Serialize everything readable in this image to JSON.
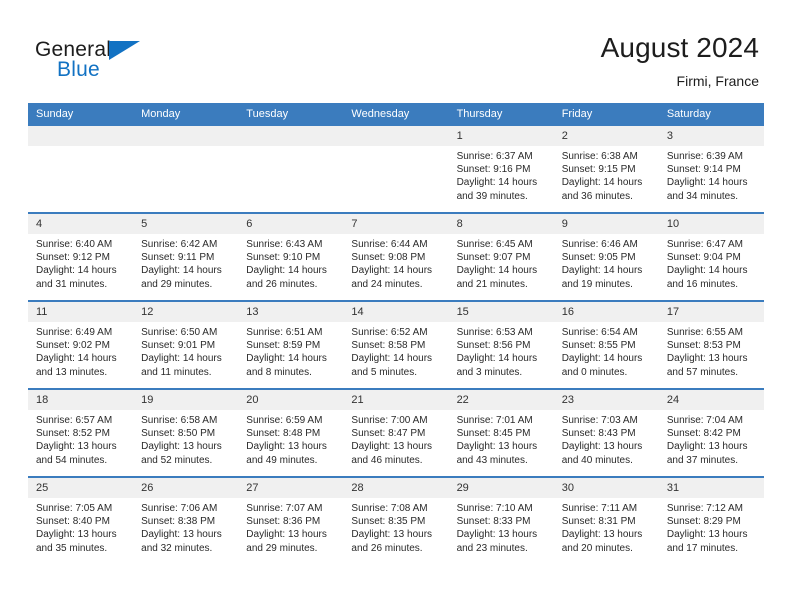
{
  "logo": {
    "primary_text": "General",
    "secondary_text": "Blue",
    "accent_color": "#1272c3"
  },
  "header": {
    "title": "August 2024",
    "location": "Firmi, France",
    "header_bg_color": "#3b7cbe"
  },
  "weekday_headers": [
    "Sunday",
    "Monday",
    "Tuesday",
    "Wednesday",
    "Thursday",
    "Friday",
    "Saturday"
  ],
  "weeks": [
    [
      {
        "date": "",
        "sunrise": "",
        "sunset": "",
        "daylight": ""
      },
      {
        "date": "",
        "sunrise": "",
        "sunset": "",
        "daylight": ""
      },
      {
        "date": "",
        "sunrise": "",
        "sunset": "",
        "daylight": ""
      },
      {
        "date": "",
        "sunrise": "",
        "sunset": "",
        "daylight": ""
      },
      {
        "date": "1",
        "sunrise": "Sunrise: 6:37 AM",
        "sunset": "Sunset: 9:16 PM",
        "daylight": "Daylight: 14 hours and 39 minutes."
      },
      {
        "date": "2",
        "sunrise": "Sunrise: 6:38 AM",
        "sunset": "Sunset: 9:15 PM",
        "daylight": "Daylight: 14 hours and 36 minutes."
      },
      {
        "date": "3",
        "sunrise": "Sunrise: 6:39 AM",
        "sunset": "Sunset: 9:14 PM",
        "daylight": "Daylight: 14 hours and 34 minutes."
      }
    ],
    [
      {
        "date": "4",
        "sunrise": "Sunrise: 6:40 AM",
        "sunset": "Sunset: 9:12 PM",
        "daylight": "Daylight: 14 hours and 31 minutes."
      },
      {
        "date": "5",
        "sunrise": "Sunrise: 6:42 AM",
        "sunset": "Sunset: 9:11 PM",
        "daylight": "Daylight: 14 hours and 29 minutes."
      },
      {
        "date": "6",
        "sunrise": "Sunrise: 6:43 AM",
        "sunset": "Sunset: 9:10 PM",
        "daylight": "Daylight: 14 hours and 26 minutes."
      },
      {
        "date": "7",
        "sunrise": "Sunrise: 6:44 AM",
        "sunset": "Sunset: 9:08 PM",
        "daylight": "Daylight: 14 hours and 24 minutes."
      },
      {
        "date": "8",
        "sunrise": "Sunrise: 6:45 AM",
        "sunset": "Sunset: 9:07 PM",
        "daylight": "Daylight: 14 hours and 21 minutes."
      },
      {
        "date": "9",
        "sunrise": "Sunrise: 6:46 AM",
        "sunset": "Sunset: 9:05 PM",
        "daylight": "Daylight: 14 hours and 19 minutes."
      },
      {
        "date": "10",
        "sunrise": "Sunrise: 6:47 AM",
        "sunset": "Sunset: 9:04 PM",
        "daylight": "Daylight: 14 hours and 16 minutes."
      }
    ],
    [
      {
        "date": "11",
        "sunrise": "Sunrise: 6:49 AM",
        "sunset": "Sunset: 9:02 PM",
        "daylight": "Daylight: 14 hours and 13 minutes."
      },
      {
        "date": "12",
        "sunrise": "Sunrise: 6:50 AM",
        "sunset": "Sunset: 9:01 PM",
        "daylight": "Daylight: 14 hours and 11 minutes."
      },
      {
        "date": "13",
        "sunrise": "Sunrise: 6:51 AM",
        "sunset": "Sunset: 8:59 PM",
        "daylight": "Daylight: 14 hours and 8 minutes."
      },
      {
        "date": "14",
        "sunrise": "Sunrise: 6:52 AM",
        "sunset": "Sunset: 8:58 PM",
        "daylight": "Daylight: 14 hours and 5 minutes."
      },
      {
        "date": "15",
        "sunrise": "Sunrise: 6:53 AM",
        "sunset": "Sunset: 8:56 PM",
        "daylight": "Daylight: 14 hours and 3 minutes."
      },
      {
        "date": "16",
        "sunrise": "Sunrise: 6:54 AM",
        "sunset": "Sunset: 8:55 PM",
        "daylight": "Daylight: 14 hours and 0 minutes."
      },
      {
        "date": "17",
        "sunrise": "Sunrise: 6:55 AM",
        "sunset": "Sunset: 8:53 PM",
        "daylight": "Daylight: 13 hours and 57 minutes."
      }
    ],
    [
      {
        "date": "18",
        "sunrise": "Sunrise: 6:57 AM",
        "sunset": "Sunset: 8:52 PM",
        "daylight": "Daylight: 13 hours and 54 minutes."
      },
      {
        "date": "19",
        "sunrise": "Sunrise: 6:58 AM",
        "sunset": "Sunset: 8:50 PM",
        "daylight": "Daylight: 13 hours and 52 minutes."
      },
      {
        "date": "20",
        "sunrise": "Sunrise: 6:59 AM",
        "sunset": "Sunset: 8:48 PM",
        "daylight": "Daylight: 13 hours and 49 minutes."
      },
      {
        "date": "21",
        "sunrise": "Sunrise: 7:00 AM",
        "sunset": "Sunset: 8:47 PM",
        "daylight": "Daylight: 13 hours and 46 minutes."
      },
      {
        "date": "22",
        "sunrise": "Sunrise: 7:01 AM",
        "sunset": "Sunset: 8:45 PM",
        "daylight": "Daylight: 13 hours and 43 minutes."
      },
      {
        "date": "23",
        "sunrise": "Sunrise: 7:03 AM",
        "sunset": "Sunset: 8:43 PM",
        "daylight": "Daylight: 13 hours and 40 minutes."
      },
      {
        "date": "24",
        "sunrise": "Sunrise: 7:04 AM",
        "sunset": "Sunset: 8:42 PM",
        "daylight": "Daylight: 13 hours and 37 minutes."
      }
    ],
    [
      {
        "date": "25",
        "sunrise": "Sunrise: 7:05 AM",
        "sunset": "Sunset: 8:40 PM",
        "daylight": "Daylight: 13 hours and 35 minutes."
      },
      {
        "date": "26",
        "sunrise": "Sunrise: 7:06 AM",
        "sunset": "Sunset: 8:38 PM",
        "daylight": "Daylight: 13 hours and 32 minutes."
      },
      {
        "date": "27",
        "sunrise": "Sunrise: 7:07 AM",
        "sunset": "Sunset: 8:36 PM",
        "daylight": "Daylight: 13 hours and 29 minutes."
      },
      {
        "date": "28",
        "sunrise": "Sunrise: 7:08 AM",
        "sunset": "Sunset: 8:35 PM",
        "daylight": "Daylight: 13 hours and 26 minutes."
      },
      {
        "date": "29",
        "sunrise": "Sunrise: 7:10 AM",
        "sunset": "Sunset: 8:33 PM",
        "daylight": "Daylight: 13 hours and 23 minutes."
      },
      {
        "date": "30",
        "sunrise": "Sunrise: 7:11 AM",
        "sunset": "Sunset: 8:31 PM",
        "daylight": "Daylight: 13 hours and 20 minutes."
      },
      {
        "date": "31",
        "sunrise": "Sunrise: 7:12 AM",
        "sunset": "Sunset: 8:29 PM",
        "daylight": "Daylight: 13 hours and 17 minutes."
      }
    ]
  ]
}
